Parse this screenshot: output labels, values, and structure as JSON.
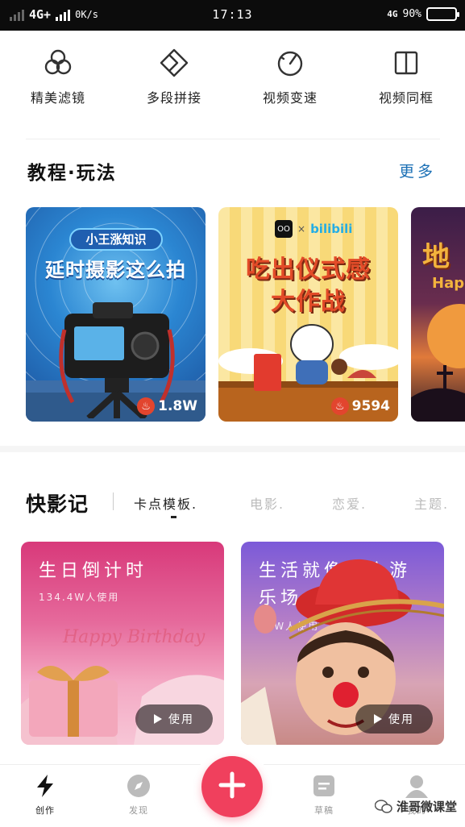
{
  "status_bar": {
    "network": "4G+",
    "speed": "0K/s",
    "time": "17:13",
    "network_right": "4G",
    "battery": "90%",
    "battery_level": 0.9
  },
  "tools": [
    {
      "label": "精美滤镜",
      "icon": "filter-icon"
    },
    {
      "label": "多段拼接",
      "icon": "splice-icon"
    },
    {
      "label": "视频变速",
      "icon": "speed-icon"
    },
    {
      "label": "视频同框",
      "icon": "split-frame-icon"
    }
  ],
  "tutorials": {
    "title": "教程·玩法",
    "more": "更多",
    "cards": [
      {
        "badge": "小王涨知识",
        "title": "延时摄影这么拍",
        "views": "1.8W"
      },
      {
        "brand": "bilibili",
        "title_line1": "吃出仪式感",
        "title_line2": "大作战",
        "views": "9594"
      },
      {
        "title": "地",
        "subtitle": "Hap"
      }
    ]
  },
  "kuaiyingji": {
    "title": "快影记",
    "tabs": [
      "卡点模板.",
      "电影.",
      "恋爱.",
      "主题."
    ],
    "active_tab": 0,
    "templates": [
      {
        "title": "生日倒计时",
        "usage": "134.4W人使用",
        "overlay_text": "Happy Birthday",
        "button": "使用"
      },
      {
        "title_line1": "生活就像一个游",
        "title_line2": "乐场",
        "usage": "12W人使用",
        "button": "使用"
      }
    ]
  },
  "bottom_nav": {
    "items": [
      {
        "label": "创作",
        "icon": "lightning-icon"
      },
      {
        "label": "发现",
        "icon": "compass-icon"
      },
      {
        "label": "草稿",
        "icon": "drafts-icon"
      },
      {
        "label": "我的",
        "icon": "profile-icon"
      }
    ],
    "fab_icon": "plus-icon"
  },
  "watermark": "淮哥微课堂",
  "colors": {
    "accent": "#f0405d",
    "link": "#1a6fb5"
  }
}
